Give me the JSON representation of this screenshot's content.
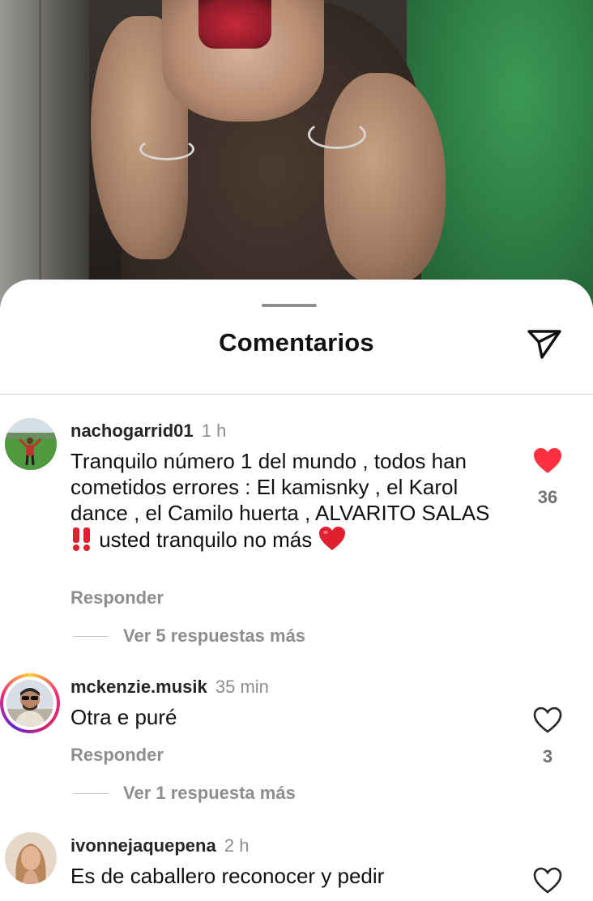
{
  "sheet": {
    "title": "Comentarios"
  },
  "icons": {
    "send": "paper-plane-icon",
    "like_filled": "heart-filled-icon",
    "like_outline": "heart-outline-icon"
  },
  "colors": {
    "like_red": "#ff3040",
    "ring_gradient": [
      "#f9ce34",
      "#ee2a7b",
      "#6228d7"
    ],
    "muted_text": "#8e8e8e"
  },
  "comments": [
    {
      "username": "nachogarrid01",
      "time": "1 h",
      "text_part1": "Tranquilo número 1 del mundo , todos han cometidos errores : El kamisnky , el Karol dance , el Camilo huerta , ALVARITO SALAS",
      "emoji1": "‼️",
      "text_part2": " usted tranquilo no más ",
      "emoji2": "❤️",
      "liked": true,
      "like_count": "36",
      "reply_label": "Responder",
      "more_replies": "Ver 5 respuestas más"
    },
    {
      "username": "mckenzie.musik",
      "time": "35 min",
      "text": "Otra e puré",
      "liked": false,
      "like_count": "3",
      "reply_label": "Responder",
      "more_replies": "Ver 1 respuesta más"
    },
    {
      "username": "ivonnejaquepena",
      "time": "2 h",
      "text": "Es de caballero reconocer y pedir",
      "liked": false
    }
  ]
}
